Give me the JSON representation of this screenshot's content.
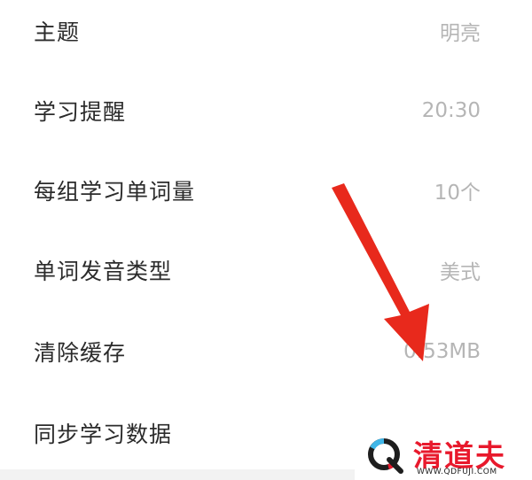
{
  "settings": [
    {
      "label": "主题",
      "value": "明亮"
    },
    {
      "label": "学习提醒",
      "value": "20:30"
    },
    {
      "label": "每组学习单词量",
      "value": "10个"
    },
    {
      "label": "单词发音类型",
      "value": "美式"
    },
    {
      "label": "清除缓存",
      "value": "0.53MB"
    },
    {
      "label": "同步学习数据",
      "value": ""
    }
  ],
  "watermark": {
    "name": "清道夫",
    "url": "WWW.QDFUJI.COM"
  },
  "colors": {
    "arrow": "#e8291c",
    "label": "#2b2b2b",
    "value": "#b5b5b5",
    "brand": "#e8192c"
  }
}
